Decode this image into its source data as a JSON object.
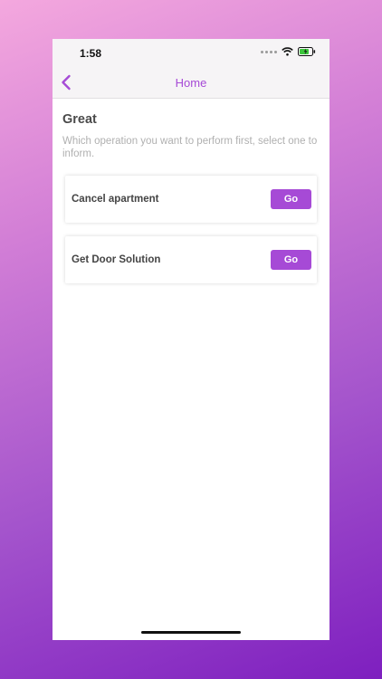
{
  "status_bar": {
    "time": "1:58",
    "icons": [
      "signal-dots-icon",
      "wifi-icon",
      "battery-charging-icon"
    ]
  },
  "nav": {
    "back_icon": "chevron-left-icon",
    "title": "Home"
  },
  "main": {
    "heading": "Great",
    "subtext": "Which operation you want to perform first, select one to inform.",
    "options": [
      {
        "label": "Cancel apartment",
        "button_label": "Go"
      },
      {
        "label": "Get Door Solution",
        "button_label": "Go"
      }
    ]
  },
  "colors": {
    "accent": "#a64ad6",
    "background_top": "#f4a8de",
    "background_bottom": "#7e1fbf"
  }
}
